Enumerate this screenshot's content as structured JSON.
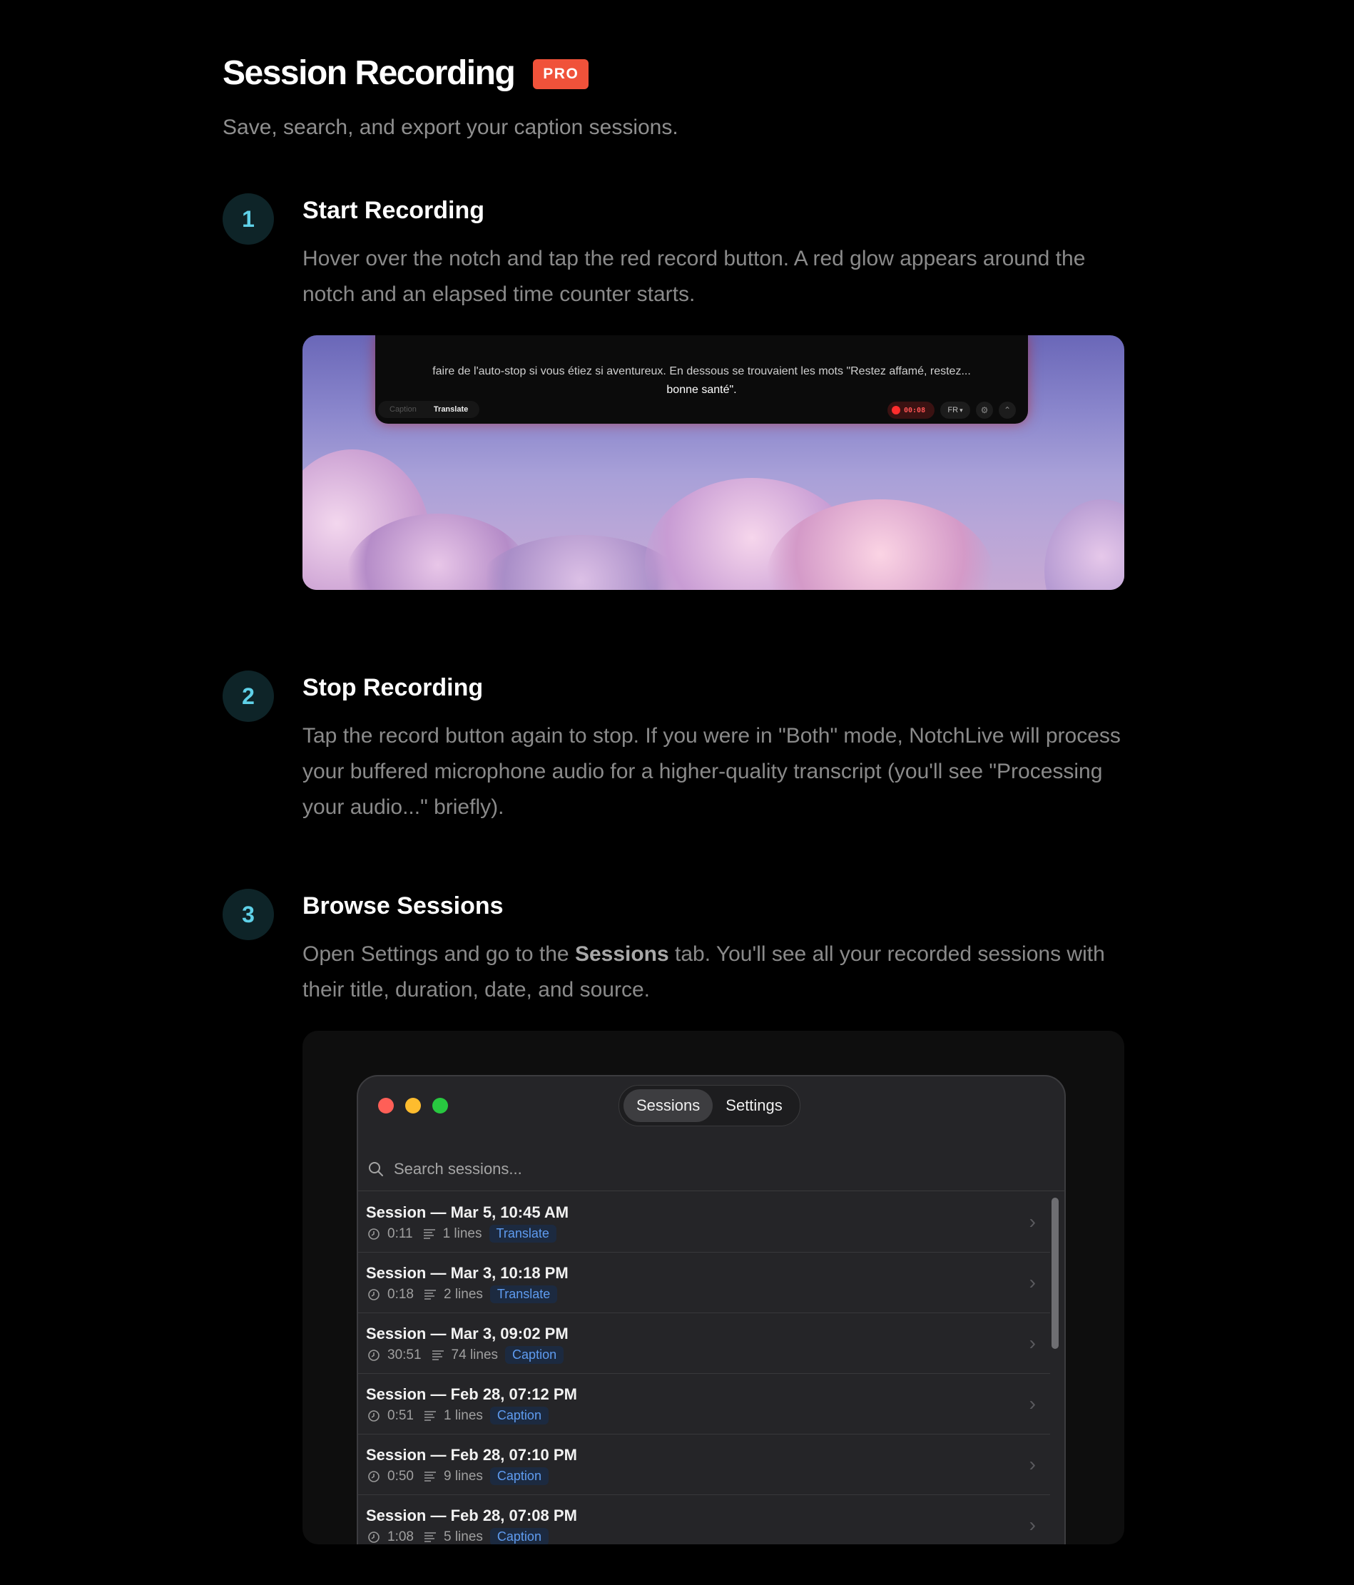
{
  "header": {
    "title": "Session Recording",
    "badge": "PRO",
    "subtitle": "Save, search, and export your caption sessions."
  },
  "steps": [
    {
      "number": "1",
      "title": "Start Recording",
      "description": "Hover over the notch and tap the red record button. A red glow appears around the notch and an elapsed time counter starts."
    },
    {
      "number": "2",
      "title": "Stop Recording",
      "description": "Tap the record button again to stop. If you were in \"Both\" mode, NotchLive will process your buffered microphone audio for a higher-quality transcript (you'll see \"Processing your audio...\" briefly)."
    },
    {
      "number": "3",
      "title": "Browse Sessions",
      "description_before": "Open Settings and go to the ",
      "description_bold": "Sessions",
      "description_after": " tab. You'll see all your recorded sessions with their title, duration, date, and source."
    }
  ],
  "notch": {
    "caption_line1": "faire de l'auto-stop si vous étiez si aventureux. En dessous se trouvaient les mots \"Restez affamé, restez...",
    "caption_line2": "bonne santé\".",
    "tab_caption": "Caption",
    "tab_translate": "Translate",
    "timer": "00:08",
    "language": "FR",
    "gear_icon": "⚙",
    "collapse_icon": "⌃"
  },
  "app": {
    "tabs": [
      "Sessions",
      "Settings"
    ],
    "active_tab": "Sessions",
    "search_placeholder": "Search sessions...",
    "sessions": [
      {
        "title": "Session — Mar 5, 10:45 AM",
        "duration": "0:11",
        "lines": "1 lines",
        "source": "Translate"
      },
      {
        "title": "Session — Mar 3, 10:18 PM",
        "duration": "0:18",
        "lines": "2 lines",
        "source": "Translate"
      },
      {
        "title": "Session — Mar 3, 09:02 PM",
        "duration": "30:51",
        "lines": "74 lines",
        "source": "Caption"
      },
      {
        "title": "Session — Feb 28, 07:12 PM",
        "duration": "0:51",
        "lines": "1 lines",
        "source": "Caption"
      },
      {
        "title": "Session — Feb 28, 07:10 PM",
        "duration": "0:50",
        "lines": "9 lines",
        "source": "Caption"
      },
      {
        "title": "Session — Feb 28, 07:08 PM",
        "duration": "1:08",
        "lines": "5 lines",
        "source": "Caption"
      }
    ]
  },
  "colors": {
    "accent": "#f0523a",
    "step_number": "#5fd1e8",
    "badge_text": "#5f9cf0",
    "traffic_red": "#ff5f57",
    "traffic_yellow": "#febc2e",
    "traffic_green": "#28c840"
  }
}
